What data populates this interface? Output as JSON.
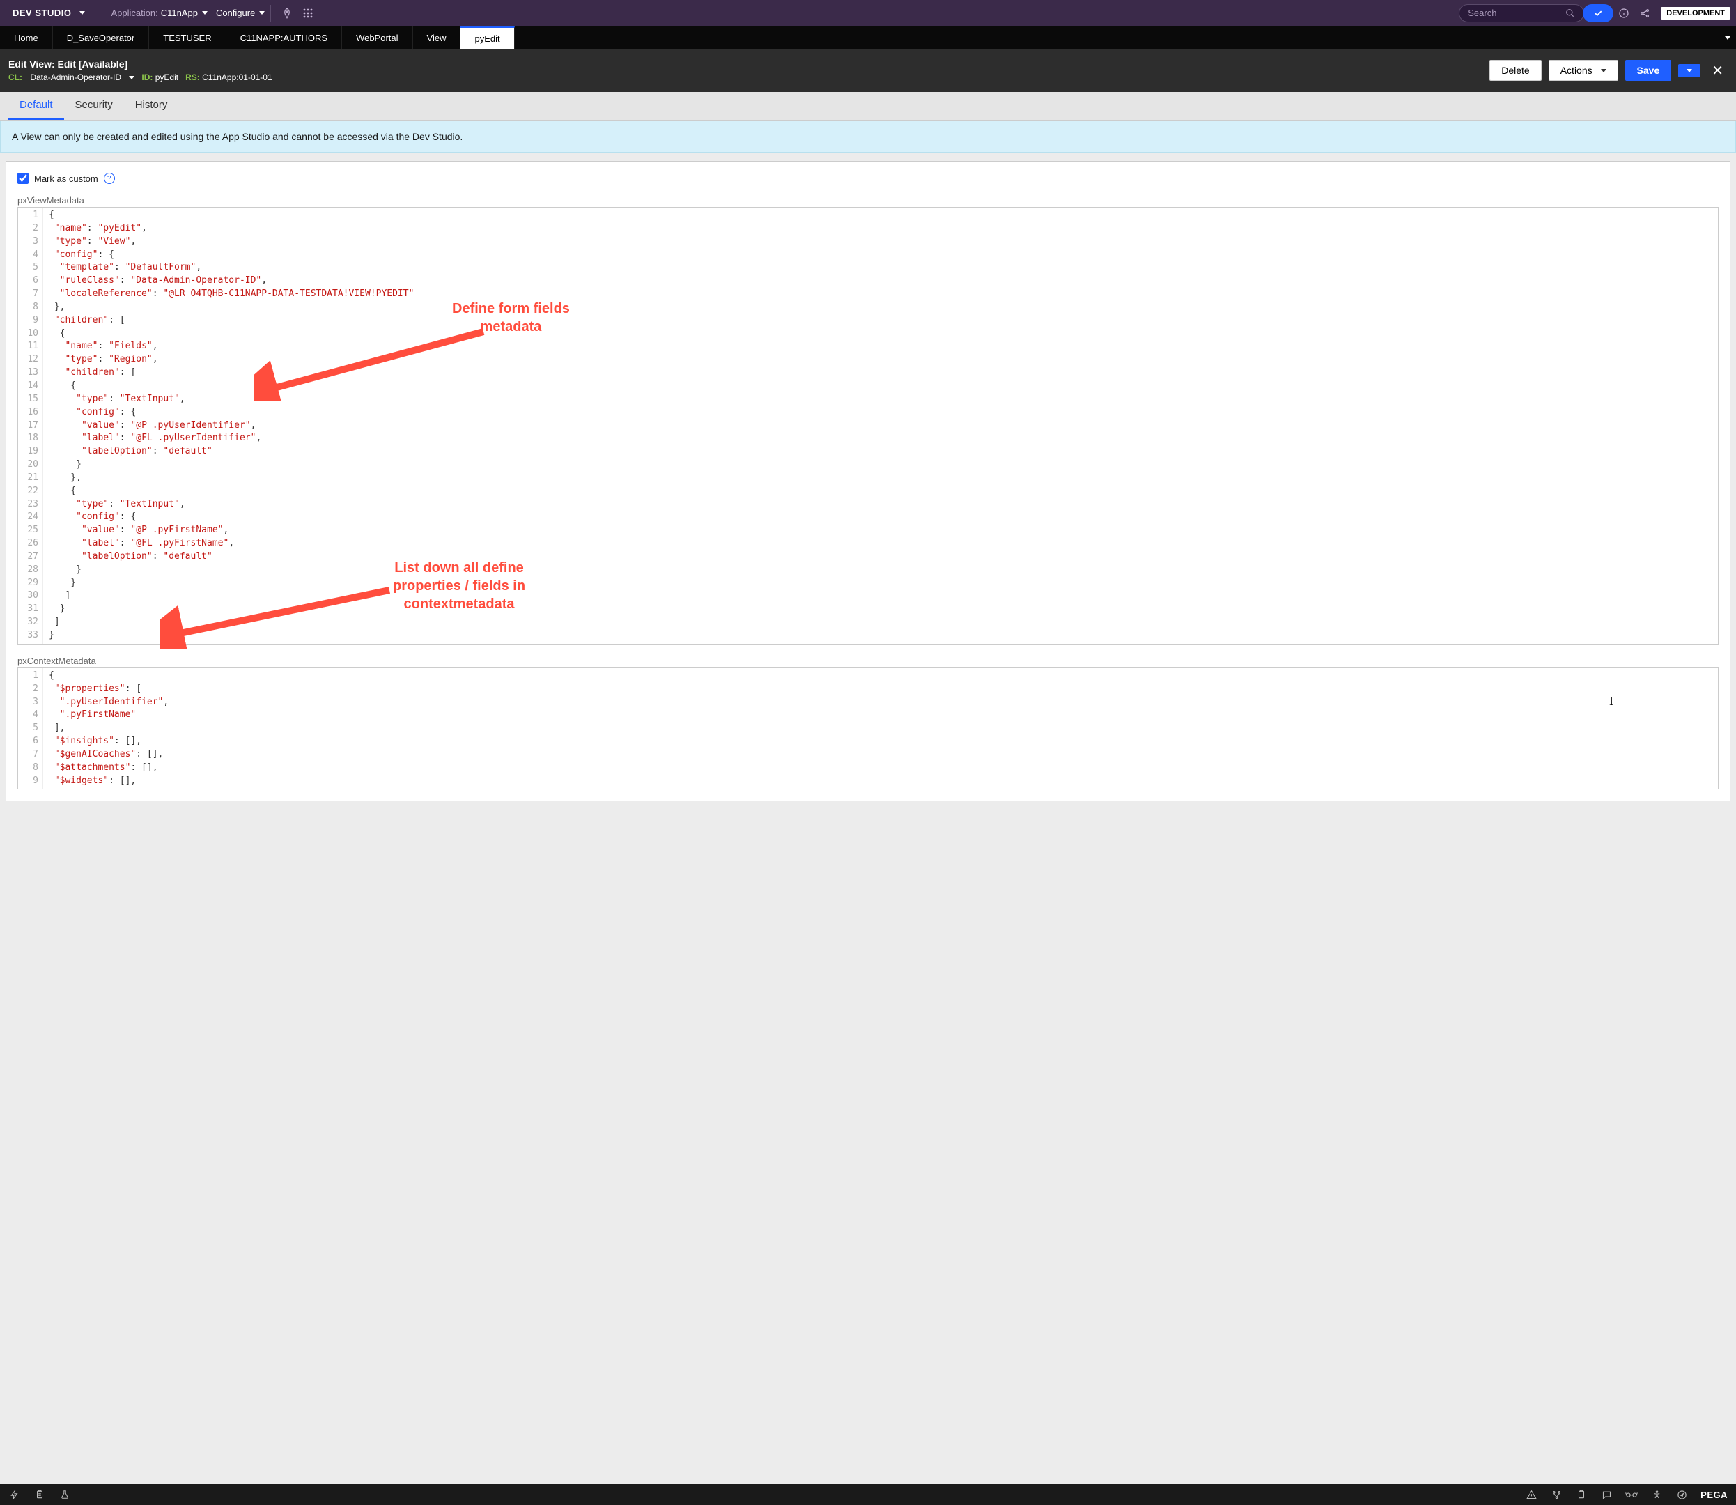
{
  "topbar": {
    "brand": "DEV STUDIO",
    "app_label": "Application:",
    "app_value": "C11nApp",
    "configure": "Configure",
    "search_placeholder": "Search",
    "env_badge": "DEVELOPMENT"
  },
  "tabs": [
    {
      "label": "Home"
    },
    {
      "label": "D_SaveOperator"
    },
    {
      "label": "TESTUSER"
    },
    {
      "label": "C11NAPP:AUTHORS"
    },
    {
      "label": "WebPortal"
    },
    {
      "label": "View"
    },
    {
      "label": "pyEdit",
      "active": true
    }
  ],
  "header": {
    "title": "Edit  View: Edit [Available]",
    "cl_key": "CL:",
    "cl_val": "Data-Admin-Operator-ID",
    "id_key": "ID:",
    "id_val": "pyEdit",
    "rs_key": "RS:",
    "rs_val": "C11nApp:01-01-01",
    "delete": "Delete",
    "actions": "Actions",
    "save": "Save"
  },
  "subtabs": [
    {
      "label": "Default",
      "active": true
    },
    {
      "label": "Security"
    },
    {
      "label": "History"
    }
  ],
  "banner": "A View can only be created and edited using the App Studio and cannot be accessed via the Dev Studio.",
  "checkbox_label": "Mark as custom",
  "editor1_label": "pxViewMetadata",
  "editor2_label": "pxContextMetadata",
  "ann1": "Define form fields metadata",
  "ann2": "List down all define properties / fields in contextmetadata",
  "code1": [
    [
      [
        "p",
        "{"
      ]
    ],
    [
      [
        "p",
        " "
      ],
      [
        "k",
        "\"name\""
      ],
      [
        "p",
        ": "
      ],
      [
        "s",
        "\"pyEdit\""
      ],
      [
        "p",
        ","
      ]
    ],
    [
      [
        "p",
        " "
      ],
      [
        "k",
        "\"type\""
      ],
      [
        "p",
        ": "
      ],
      [
        "s",
        "\"View\""
      ],
      [
        "p",
        ","
      ]
    ],
    [
      [
        "p",
        " "
      ],
      [
        "k",
        "\"config\""
      ],
      [
        "p",
        ": {"
      ]
    ],
    [
      [
        "p",
        "  "
      ],
      [
        "k",
        "\"template\""
      ],
      [
        "p",
        ": "
      ],
      [
        "s",
        "\"DefaultForm\""
      ],
      [
        "p",
        ","
      ]
    ],
    [
      [
        "p",
        "  "
      ],
      [
        "k",
        "\"ruleClass\""
      ],
      [
        "p",
        ": "
      ],
      [
        "s",
        "\"Data-Admin-Operator-ID\""
      ],
      [
        "p",
        ","
      ]
    ],
    [
      [
        "p",
        "  "
      ],
      [
        "k",
        "\"localeReference\""
      ],
      [
        "p",
        ": "
      ],
      [
        "s",
        "\"@LR O4TQHB-C11NAPP-DATA-TESTDATA!VIEW!PYEDIT\""
      ]
    ],
    [
      [
        "p",
        " },"
      ]
    ],
    [
      [
        "p",
        " "
      ],
      [
        "k",
        "\"children\""
      ],
      [
        "p",
        ": ["
      ]
    ],
    [
      [
        "p",
        "  {"
      ]
    ],
    [
      [
        "p",
        "   "
      ],
      [
        "k",
        "\"name\""
      ],
      [
        "p",
        ": "
      ],
      [
        "s",
        "\"Fields\""
      ],
      [
        "p",
        ","
      ]
    ],
    [
      [
        "p",
        "   "
      ],
      [
        "k",
        "\"type\""
      ],
      [
        "p",
        ": "
      ],
      [
        "s",
        "\"Region\""
      ],
      [
        "p",
        ","
      ]
    ],
    [
      [
        "p",
        "   "
      ],
      [
        "k",
        "\"children\""
      ],
      [
        "p",
        ": ["
      ]
    ],
    [
      [
        "p",
        "    {"
      ]
    ],
    [
      [
        "p",
        "     "
      ],
      [
        "k",
        "\"type\""
      ],
      [
        "p",
        ": "
      ],
      [
        "s",
        "\"TextInput\""
      ],
      [
        "p",
        ","
      ]
    ],
    [
      [
        "p",
        "     "
      ],
      [
        "k",
        "\"config\""
      ],
      [
        "p",
        ": {"
      ]
    ],
    [
      [
        "p",
        "      "
      ],
      [
        "k",
        "\"value\""
      ],
      [
        "p",
        ": "
      ],
      [
        "s",
        "\"@P .pyUserIdentifier\""
      ],
      [
        "p",
        ","
      ]
    ],
    [
      [
        "p",
        "      "
      ],
      [
        "k",
        "\"label\""
      ],
      [
        "p",
        ": "
      ],
      [
        "s",
        "\"@FL .pyUserIdentifier\""
      ],
      [
        "p",
        ","
      ]
    ],
    [
      [
        "p",
        "      "
      ],
      [
        "k",
        "\"labelOption\""
      ],
      [
        "p",
        ": "
      ],
      [
        "s",
        "\"default\""
      ]
    ],
    [
      [
        "p",
        "     }"
      ]
    ],
    [
      [
        "p",
        "    },"
      ]
    ],
    [
      [
        "p",
        "    {"
      ]
    ],
    [
      [
        "p",
        "     "
      ],
      [
        "k",
        "\"type\""
      ],
      [
        "p",
        ": "
      ],
      [
        "s",
        "\"TextInput\""
      ],
      [
        "p",
        ","
      ]
    ],
    [
      [
        "p",
        "     "
      ],
      [
        "k",
        "\"config\""
      ],
      [
        "p",
        ": {"
      ]
    ],
    [
      [
        "p",
        "      "
      ],
      [
        "k",
        "\"value\""
      ],
      [
        "p",
        ": "
      ],
      [
        "s",
        "\"@P .pyFirstName\""
      ],
      [
        "p",
        ","
      ]
    ],
    [
      [
        "p",
        "      "
      ],
      [
        "k",
        "\"label\""
      ],
      [
        "p",
        ": "
      ],
      [
        "s",
        "\"@FL .pyFirstName\""
      ],
      [
        "p",
        ","
      ]
    ],
    [
      [
        "p",
        "      "
      ],
      [
        "k",
        "\"labelOption\""
      ],
      [
        "p",
        ": "
      ],
      [
        "s",
        "\"default\""
      ]
    ],
    [
      [
        "p",
        "     }"
      ]
    ],
    [
      [
        "p",
        "    }"
      ]
    ],
    [
      [
        "p",
        "   ]"
      ]
    ],
    [
      [
        "p",
        "  }"
      ]
    ],
    [
      [
        "p",
        " ]"
      ]
    ],
    [
      [
        "p",
        "}"
      ]
    ]
  ],
  "code2": [
    [
      [
        "p",
        "{"
      ]
    ],
    [
      [
        "p",
        " "
      ],
      [
        "k",
        "\"$properties\""
      ],
      [
        "p",
        ": ["
      ]
    ],
    [
      [
        "p",
        "  "
      ],
      [
        "s",
        "\".pyUserIdentifier\""
      ],
      [
        "p",
        ","
      ]
    ],
    [
      [
        "p",
        "  "
      ],
      [
        "s",
        "\".pyFirstName\""
      ]
    ],
    [
      [
        "p",
        " ],"
      ]
    ],
    [
      [
        "p",
        " "
      ],
      [
        "k",
        "\"$insights\""
      ],
      [
        "p",
        ": [],"
      ]
    ],
    [
      [
        "p",
        " "
      ],
      [
        "k",
        "\"$genAICoaches\""
      ],
      [
        "p",
        ": [],"
      ]
    ],
    [
      [
        "p",
        " "
      ],
      [
        "k",
        "\"$attachments\""
      ],
      [
        "p",
        ": [],"
      ]
    ],
    [
      [
        "p",
        " "
      ],
      [
        "k",
        "\"$widgets\""
      ],
      [
        "p",
        ": [],"
      ]
    ]
  ],
  "footer_brand": "PEGA"
}
